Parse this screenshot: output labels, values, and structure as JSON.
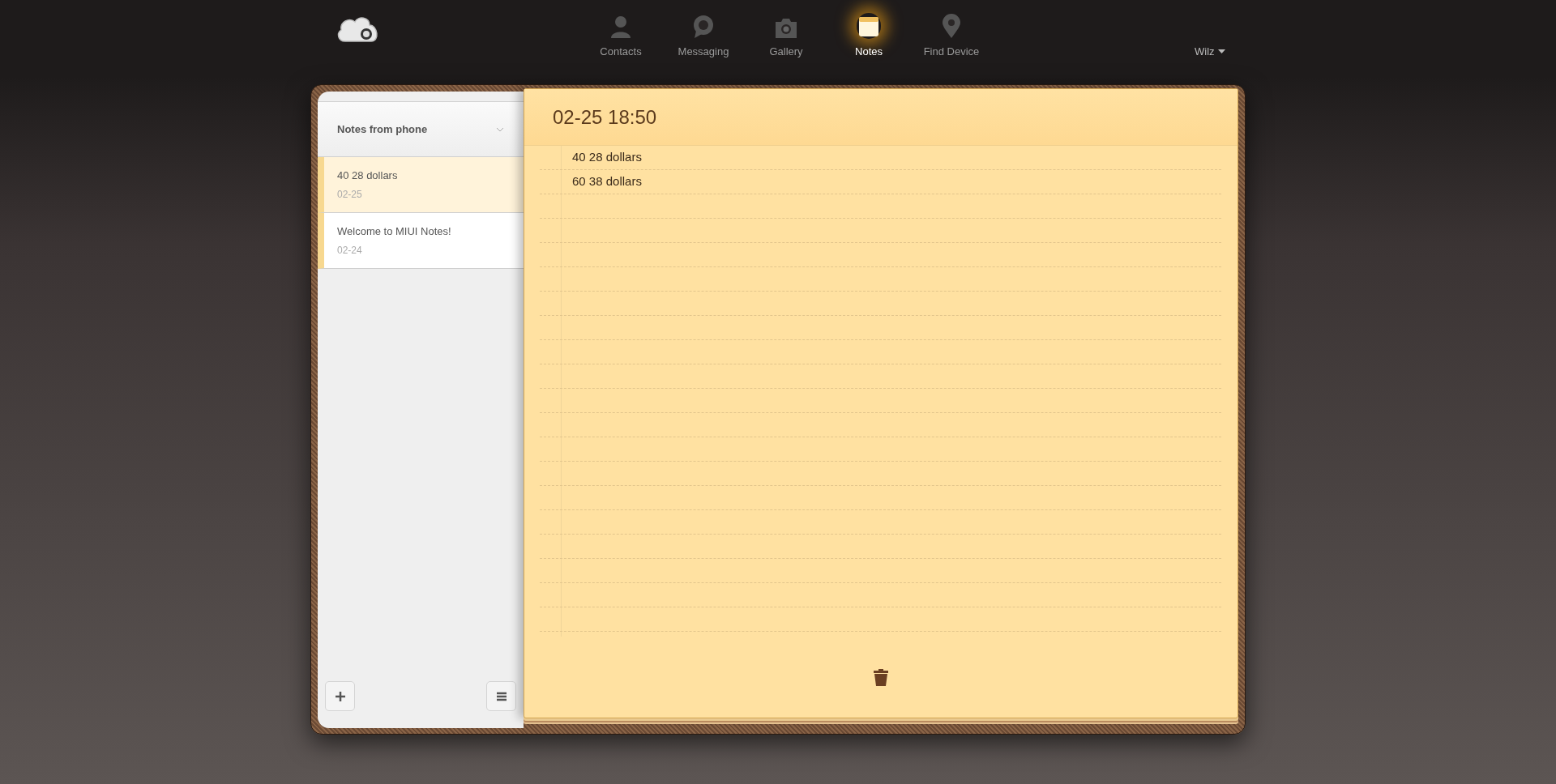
{
  "nav": {
    "items": [
      {
        "label": "Contacts",
        "kind": "contacts",
        "selected": false
      },
      {
        "label": "Messaging",
        "kind": "messaging",
        "selected": false
      },
      {
        "label": "Gallery",
        "kind": "gallery",
        "selected": false
      },
      {
        "label": "Notes",
        "kind": "notes",
        "selected": true
      },
      {
        "label": "Find Device",
        "kind": "find",
        "selected": false
      }
    ],
    "user": "Wilz"
  },
  "sidebar": {
    "folder": "Notes from phone",
    "notes": [
      {
        "title": "40 28 dollars",
        "date": "02-25",
        "selected": true
      },
      {
        "title": "Welcome to MIUI Notes!",
        "date": "02-24",
        "selected": false
      }
    ]
  },
  "note": {
    "title": "02-25 18:50",
    "lines": [
      "40 28 dollars",
      "60 38 dollars"
    ]
  }
}
